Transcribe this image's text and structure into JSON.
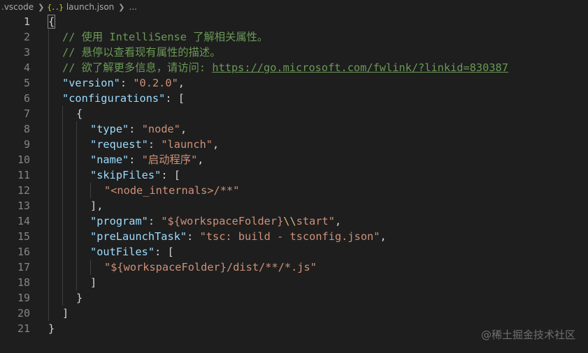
{
  "breadcrumb": {
    "folder": ".vscode",
    "file_icon": "{..}",
    "file": "launch.json",
    "more": "..."
  },
  "colors": {
    "background": "#1e1e1e",
    "key": "#9cdcfe",
    "string": "#ce9178",
    "comment": "#6a9955",
    "punctuation": "#d4d4d4",
    "escape": "#d7ba7d",
    "line_number": "#858585",
    "current_line_number": "#c6c6c6"
  },
  "editor": {
    "current_line": 1,
    "lines": [
      {
        "n": "1",
        "indent": 0,
        "tokens": [
          {
            "t": "{",
            "c": "brace-hl"
          }
        ]
      },
      {
        "n": "2",
        "indent": 1,
        "tokens": [
          {
            "t": "// 使用 IntelliSense 了解相关属性。",
            "c": "comment"
          }
        ]
      },
      {
        "n": "3",
        "indent": 1,
        "tokens": [
          {
            "t": "// 悬停以查看现有属性的描述。",
            "c": "comment"
          }
        ]
      },
      {
        "n": "4",
        "indent": 1,
        "tokens": [
          {
            "t": "// 欲了解更多信息，请访问: ",
            "c": "comment"
          },
          {
            "t": "https://go.microsoft.com/fwlink/?linkid=830387",
            "c": "link"
          }
        ]
      },
      {
        "n": "5",
        "indent": 1,
        "tokens": [
          {
            "t": "\"version\"",
            "c": "key"
          },
          {
            "t": ": ",
            "c": "punc"
          },
          {
            "t": "\"0.2.0\"",
            "c": "str"
          },
          {
            "t": ",",
            "c": "punc"
          }
        ]
      },
      {
        "n": "6",
        "indent": 1,
        "tokens": [
          {
            "t": "\"configurations\"",
            "c": "key"
          },
          {
            "t": ": ",
            "c": "punc"
          },
          {
            "t": "[",
            "c": "bracket"
          }
        ]
      },
      {
        "n": "7",
        "indent": 2,
        "tokens": [
          {
            "t": "{",
            "c": "brace"
          }
        ]
      },
      {
        "n": "8",
        "indent": 3,
        "tokens": [
          {
            "t": "\"type\"",
            "c": "key"
          },
          {
            "t": ": ",
            "c": "punc"
          },
          {
            "t": "\"node\"",
            "c": "str"
          },
          {
            "t": ",",
            "c": "punc"
          }
        ]
      },
      {
        "n": "9",
        "indent": 3,
        "tokens": [
          {
            "t": "\"request\"",
            "c": "key"
          },
          {
            "t": ": ",
            "c": "punc"
          },
          {
            "t": "\"launch\"",
            "c": "str"
          },
          {
            "t": ",",
            "c": "punc"
          }
        ]
      },
      {
        "n": "10",
        "indent": 3,
        "tokens": [
          {
            "t": "\"name\"",
            "c": "key"
          },
          {
            "t": ": ",
            "c": "punc"
          },
          {
            "t": "\"启动程序\"",
            "c": "str"
          },
          {
            "t": ",",
            "c": "punc"
          }
        ]
      },
      {
        "n": "11",
        "indent": 3,
        "tokens": [
          {
            "t": "\"skipFiles\"",
            "c": "key"
          },
          {
            "t": ": ",
            "c": "punc"
          },
          {
            "t": "[",
            "c": "bracket"
          }
        ]
      },
      {
        "n": "12",
        "indent": 4,
        "tokens": [
          {
            "t": "\"<node_internals>/**\"",
            "c": "str"
          }
        ]
      },
      {
        "n": "13",
        "indent": 3,
        "tokens": [
          {
            "t": "],",
            "c": "bracket"
          }
        ]
      },
      {
        "n": "14",
        "indent": 3,
        "tokens": [
          {
            "t": "\"program\"",
            "c": "key"
          },
          {
            "t": ": ",
            "c": "punc"
          },
          {
            "t": "\"${workspaceFolder}",
            "c": "str"
          },
          {
            "t": "\\\\",
            "c": "escape"
          },
          {
            "t": "start\"",
            "c": "str"
          },
          {
            "t": ",",
            "c": "punc"
          }
        ]
      },
      {
        "n": "15",
        "indent": 3,
        "tokens": [
          {
            "t": "\"preLaunchTask\"",
            "c": "key"
          },
          {
            "t": ": ",
            "c": "punc"
          },
          {
            "t": "\"tsc: build - tsconfig.json\"",
            "c": "str"
          },
          {
            "t": ",",
            "c": "punc"
          }
        ]
      },
      {
        "n": "16",
        "indent": 3,
        "tokens": [
          {
            "t": "\"outFiles\"",
            "c": "key"
          },
          {
            "t": ": ",
            "c": "punc"
          },
          {
            "t": "[",
            "c": "bracket"
          }
        ]
      },
      {
        "n": "17",
        "indent": 4,
        "tokens": [
          {
            "t": "\"${workspaceFolder}/dist/**/*.js\"",
            "c": "str"
          }
        ]
      },
      {
        "n": "18",
        "indent": 3,
        "tokens": [
          {
            "t": "]",
            "c": "bracket"
          }
        ]
      },
      {
        "n": "19",
        "indent": 2,
        "tokens": [
          {
            "t": "}",
            "c": "brace"
          }
        ]
      },
      {
        "n": "20",
        "indent": 1,
        "tokens": [
          {
            "t": "]",
            "c": "bracket"
          }
        ]
      },
      {
        "n": "21",
        "indent": 0,
        "tokens": [
          {
            "t": "}",
            "c": "brace"
          }
        ]
      }
    ]
  },
  "watermark": "@稀土掘金技术社区"
}
